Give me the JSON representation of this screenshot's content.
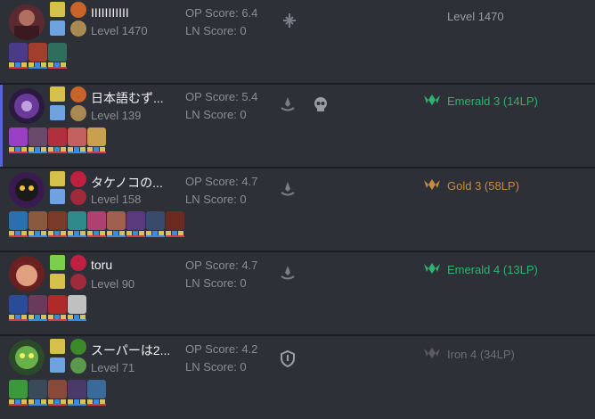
{
  "players": [
    {
      "name": "IIIIIIIIIII",
      "level": "Level 1470",
      "op_score": "OP Score: 6.4",
      "ln_score": "LN Score: 0",
      "position_icon": "fork-position-icon",
      "rank": "Level 1470",
      "rank_color": "#9a9ca4",
      "champion_count": 3,
      "colors": [
        "#4a3a8a",
        "#a0402c",
        "#2f6e5c"
      ]
    },
    {
      "name": "日本語むず...",
      "level": "Level 139",
      "op_score": "OP Score: 5.4",
      "ln_score": "LN Score: 0",
      "position_icon": "anchor-position-icon",
      "badge": "skull-icon",
      "rank": "Emerald 3 (14LP)",
      "rank_color": "#2db36b",
      "champion_count": 5,
      "colors": [
        "#9a3fc4",
        "#6a4a6a",
        "#b03040",
        "#c26060",
        "#c9a050"
      ]
    },
    {
      "name": "タケノコの...",
      "level": "Level 158",
      "op_score": "OP Score: 4.7",
      "ln_score": "LN Score: 0",
      "position_icon": "anchor-position-icon",
      "rank": "Gold 3 (58LP)",
      "rank_color": "#c98a3c",
      "champion_count": 9,
      "colors": [
        "#2a6fb0",
        "#8a5a40",
        "#7a3a2a",
        "#2e8a8a",
        "#b04070",
        "#a06050",
        "#5a3a7a",
        "#3a4a6a",
        "#6a2a20"
      ]
    },
    {
      "name": "toru",
      "level": "Level 90",
      "op_score": "OP Score: 4.7",
      "ln_score": "LN Score: 0",
      "position_icon": "anchor-position-icon",
      "rank": "Emerald 4 (13LP)",
      "rank_color": "#2db36b",
      "champion_count": 4,
      "colors": [
        "#2a4a9a",
        "#6a3a5a",
        "#b02a2a",
        "#c0c0c0"
      ]
    },
    {
      "name": "スーパーは2...",
      "level": "Level 71",
      "op_score": "OP Score: 4.2",
      "ln_score": "LN Score: 0",
      "position_icon": "shield-position-icon",
      "rank": "Iron 4 (34LP)",
      "rank_color": "#6e6f75",
      "champion_count": 5,
      "colors": [
        "#3a9a3a",
        "#3a4a5a",
        "#8a4a3a",
        "#4a3a6a",
        "#3a6a9a"
      ]
    }
  ],
  "colors": {
    "background": "#2e3038",
    "separator": "#1c1d22",
    "highlight": "#5866d4",
    "spell_yellow": "#d8c35a"
  }
}
